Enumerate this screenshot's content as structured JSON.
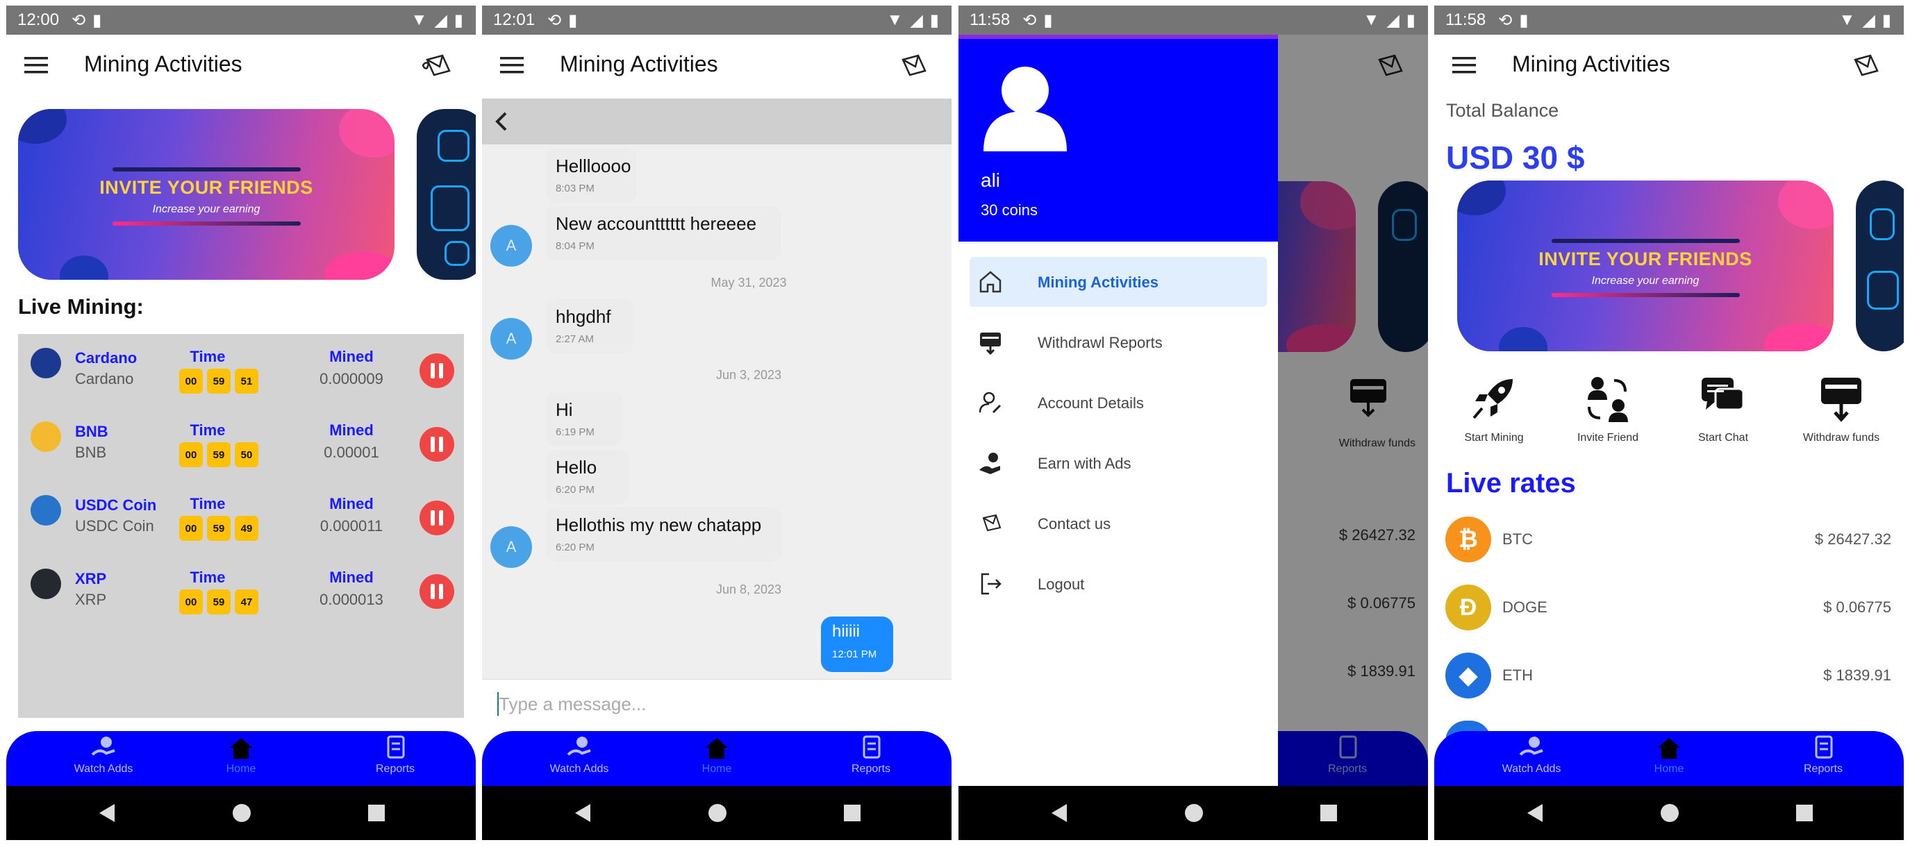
{
  "common": {
    "app_title": "Mining Activities",
    "nav": {
      "watch": "Watch Adds",
      "home": "Home",
      "reports": "Reports"
    },
    "colors": {
      "primary": "#0000ff",
      "chip": "#ffc107",
      "pause": "#ef4545",
      "accent": "#1a8cff"
    }
  },
  "screen1": {
    "time": "12:00",
    "banner": {
      "title": "INVITE YOUR FRIENDS",
      "subtitle": "Increase your earning"
    },
    "live_title": "Live Mining:",
    "rows": [
      {
        "name": "Cardano",
        "sub": "Cardano",
        "time_label": "Time",
        "h": "00",
        "m": "59",
        "s": "51",
        "mined_label": "Mined",
        "mined": "0.000009",
        "icon": "cardano-icon",
        "color": "#1b3a8f"
      },
      {
        "name": "BNB",
        "sub": "BNB",
        "time_label": "Time",
        "h": "00",
        "m": "59",
        "s": "50",
        "mined_label": "Mined",
        "mined": "0.00001",
        "icon": "bnb-icon",
        "color": "#f3ba2f"
      },
      {
        "name": "USDC Coin",
        "sub": "USDC Coin",
        "time_label": "Time",
        "h": "00",
        "m": "59",
        "s": "49",
        "mined_label": "Mined",
        "mined": "0.000011",
        "icon": "usdc-icon",
        "color": "#2775ca"
      },
      {
        "name": "XRP",
        "sub": "XRP",
        "time_label": "Time",
        "h": "00",
        "m": "59",
        "s": "47",
        "mined_label": "Mined",
        "mined": "0.000013",
        "icon": "xrp-icon",
        "color": "#23292f"
      }
    ]
  },
  "screen2": {
    "time": "12:01",
    "messages": [
      {
        "avatar": "",
        "text": "Hellloooo",
        "ts": "8:03 PM"
      },
      {
        "avatar": "A",
        "text": "New accountttttt hereeee",
        "ts": "8:04 PM"
      },
      {
        "date": "May 31, 2023"
      },
      {
        "avatar": "A",
        "text": "hhgdhf",
        "ts": "2:27 AM"
      },
      {
        "date": "Jun 3, 2023"
      },
      {
        "avatar": "",
        "text": "Hi",
        "ts": "6:19 PM"
      },
      {
        "avatar": "",
        "text": "Hello",
        "ts": "6:20 PM"
      },
      {
        "avatar": "A",
        "text": "Hellothis my new chatapp",
        "ts": "6:20 PM"
      },
      {
        "date": "Jun 8, 2023"
      }
    ],
    "my_message": {
      "text": "hiiiii",
      "ts": "12:01 PM"
    },
    "input_placeholder": "Type a message..."
  },
  "screen3": {
    "time": "11:58",
    "user": {
      "name": "ali",
      "coins": "30 coins"
    },
    "menu": [
      {
        "label": "Mining Activities",
        "icon": "home-icon"
      },
      {
        "label": "Withdrawl Reports",
        "icon": "withdraw-report-icon"
      },
      {
        "label": "Account Details",
        "icon": "account-edit-icon"
      },
      {
        "label": "Earn with Ads",
        "icon": "earn-ads-icon"
      },
      {
        "label": "Contact us",
        "icon": "contact-mail-icon"
      },
      {
        "label": "Logout",
        "icon": "logout-icon"
      }
    ],
    "behind": {
      "withdraw": "Withdraw funds",
      "btc": "$ 26427.32",
      "doge": "$ 0.06775",
      "eth": "$ 1839.91",
      "reports": "Reports"
    }
  },
  "screen4": {
    "time": "11:58",
    "total_label": "Total Balance",
    "total_value": "USD 30 $",
    "quick": [
      {
        "label": "Start Mining",
        "icon": "rocket-icon"
      },
      {
        "label": "Invite Friend",
        "icon": "invite-friend-icon"
      },
      {
        "label": "Start Chat",
        "icon": "chat-icon"
      },
      {
        "label": "Withdraw funds",
        "icon": "withdraw-icon"
      }
    ],
    "rates_title": "Live rates",
    "rates": [
      {
        "symbol": "BTC",
        "price": "$ 26427.32",
        "glyph": "₿",
        "color": "#f7931a"
      },
      {
        "symbol": "DOGE",
        "price": "$ 0.06775",
        "glyph": "Ð",
        "color": "#e2b21c"
      },
      {
        "symbol": "ETH",
        "price": "$ 1839.91",
        "glyph": "◆",
        "color": "#1e6fe0"
      }
    ]
  }
}
